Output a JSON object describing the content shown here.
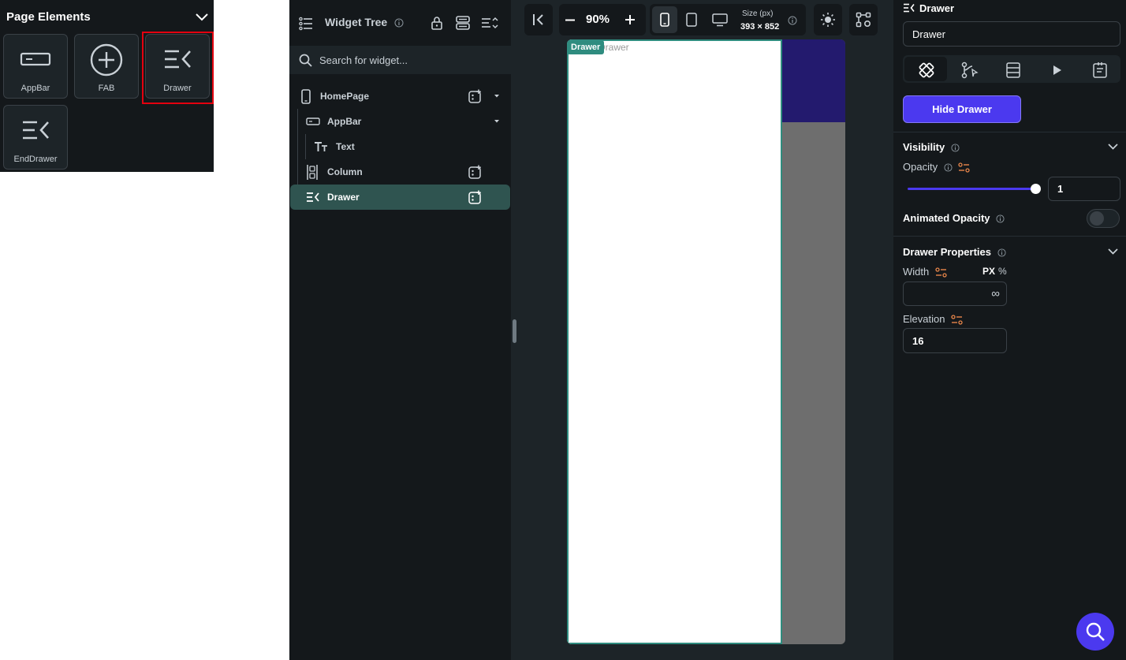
{
  "page_elements": {
    "title": "Page Elements",
    "tiles": [
      {
        "label": "AppBar",
        "icon": "appbar-icon"
      },
      {
        "label": "FAB",
        "icon": "add-circle-icon"
      },
      {
        "label": "Drawer",
        "icon": "drawer-icon"
      },
      {
        "label": "EndDrawer",
        "icon": "end-drawer-icon"
      }
    ]
  },
  "widget_tree": {
    "title": "Widget Tree",
    "search_placeholder": "Search for widget...",
    "nodes": [
      {
        "label": "HomePage",
        "icon": "phone-icon"
      },
      {
        "label": "AppBar",
        "icon": "appbar-icon"
      },
      {
        "label": "Text",
        "icon": "text-icon"
      },
      {
        "label": "Column",
        "icon": "column-icon"
      },
      {
        "label": "Drawer",
        "icon": "drawer-icon",
        "selected": true
      }
    ]
  },
  "canvas": {
    "zoom": "90%",
    "size_label": "Size (px)",
    "size_value": "393 × 852",
    "selected_tag": "Drawer",
    "ghost_text": "Drawer",
    "colors": {
      "appbar": "#231a6e",
      "drawer_border": "#2f8c7f",
      "scrim": "#6e6e6e"
    }
  },
  "properties": {
    "widget_name": "Drawer",
    "name_value": "Drawer",
    "hide_button": "Hide Drawer",
    "visibility": {
      "section": "Visibility",
      "opacity_label": "Opacity",
      "opacity_value": "1",
      "animated_label": "Animated Opacity"
    },
    "drawer_properties": {
      "section": "Drawer Properties",
      "width_label": "Width",
      "unit_px": "PX",
      "unit_pct": "%",
      "width_value": "∞",
      "elevation_label": "Elevation",
      "elevation_value": "16"
    },
    "accent_color": "#4b39ef"
  }
}
